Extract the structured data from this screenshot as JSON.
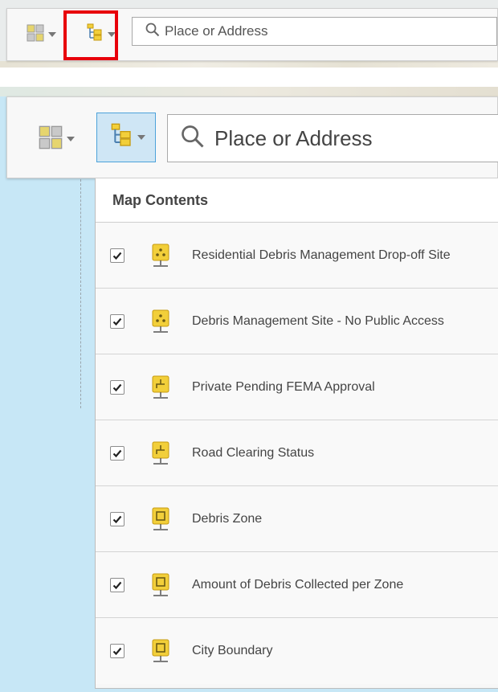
{
  "top_toolbar": {
    "basemap_button": {
      "icon": "basemap-grid-icon"
    },
    "contents_button": {
      "icon": "layer-tree-icon",
      "highlighted": true,
      "highlight_color": "#e8000b"
    },
    "search": {
      "placeholder": "Place or Address",
      "icon": "search-icon"
    }
  },
  "zoomed_toolbar": {
    "basemap_button": {
      "icon": "basemap-grid-icon"
    },
    "contents_button": {
      "icon": "layer-tree-icon",
      "active": true
    },
    "search": {
      "placeholder": "Place or Address",
      "icon": "search-icon"
    }
  },
  "map_contents": {
    "title": "Map Contents",
    "layers": [
      {
        "label": "Residential Debris Management Drop-off Site",
        "checked": true,
        "icon": "point-layer-icon"
      },
      {
        "label": "Debris Management Site - No Public Access",
        "checked": true,
        "icon": "point-layer-icon"
      },
      {
        "label": "Private Pending FEMA Approval",
        "checked": true,
        "icon": "line-layer-icon"
      },
      {
        "label": "Road Clearing Status",
        "checked": true,
        "icon": "line-layer-icon"
      },
      {
        "label": "Debris Zone",
        "checked": true,
        "icon": "polygon-layer-icon"
      },
      {
        "label": "Amount of Debris Collected per Zone",
        "checked": true,
        "icon": "polygon-layer-icon"
      },
      {
        "label": "City Boundary",
        "checked": true,
        "icon": "polygon-layer-icon"
      }
    ]
  },
  "colors": {
    "accent_blue": "#4da2da",
    "active_bg": "#cfe6f5",
    "layer_icon_yellow": "#f2cf3a",
    "map_water": "#c7e7f6"
  }
}
